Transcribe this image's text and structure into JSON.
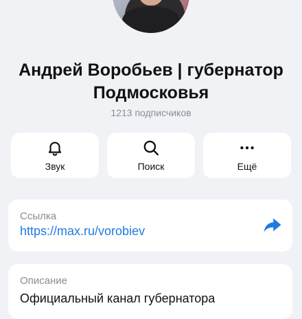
{
  "channel": {
    "title": "Андрей Воробьев | губернатор Подмосковья",
    "subscribers": "1213 подписчиков"
  },
  "actions": [
    {
      "label": "Звук",
      "icon": "bell-icon"
    },
    {
      "label": "Поиск",
      "icon": "search-icon"
    },
    {
      "label": "Ещё",
      "icon": "more-dots-icon"
    }
  ],
  "link_card": {
    "caption": "Ссылка",
    "url": "https://max.ru/vorobiev",
    "icon": "share-icon"
  },
  "description_card": {
    "caption": "Описание",
    "text": "Официальный канал губернатора"
  },
  "colors": {
    "accent": "#1f7be0",
    "background": "#f1f2f6"
  }
}
